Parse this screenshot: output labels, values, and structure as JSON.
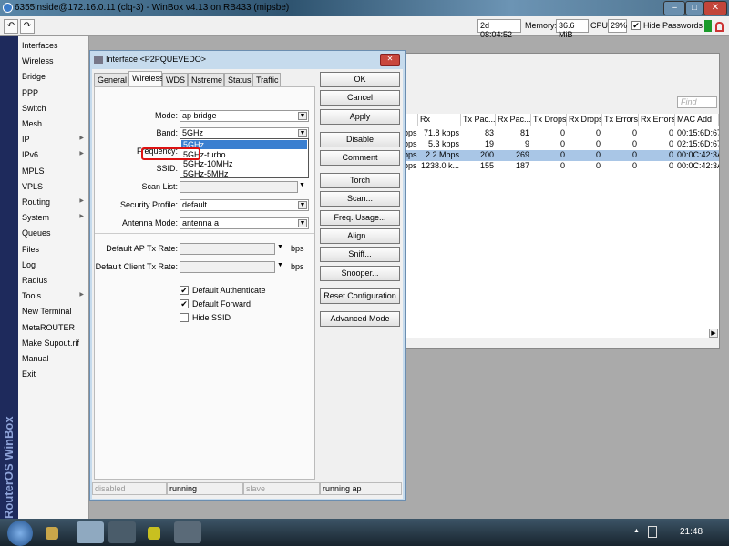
{
  "window": {
    "title": "6355inside@172.16.0.11 (clq-3) - WinBox v4.13 on RB433 (mipsbe)"
  },
  "toolbar": {
    "undo": "↶",
    "redo": "↷",
    "uptime": "2d 08:04:52",
    "memory_label": "Memory:",
    "memory": "36.6 MiB",
    "cpu_label": "CPU:",
    "cpu": "29%",
    "hide_passwords": "Hide Passwords",
    "hide_passwords_checked": true
  },
  "sidebar": {
    "brand": "RouterOS WinBox",
    "items": [
      {
        "label": "Interfaces",
        "arrow": ""
      },
      {
        "label": "Wireless",
        "arrow": ""
      },
      {
        "label": "Bridge",
        "arrow": ""
      },
      {
        "label": "PPP",
        "arrow": ""
      },
      {
        "label": "Switch",
        "arrow": ""
      },
      {
        "label": "Mesh",
        "arrow": ""
      },
      {
        "label": "IP",
        "arrow": "▶"
      },
      {
        "label": "IPv6",
        "arrow": "▶"
      },
      {
        "label": "MPLS",
        "arrow": ""
      },
      {
        "label": "VPLS",
        "arrow": ""
      },
      {
        "label": "Routing",
        "arrow": "▶"
      },
      {
        "label": "System",
        "arrow": "▶"
      },
      {
        "label": "Queues",
        "arrow": ""
      },
      {
        "label": "Files",
        "arrow": ""
      },
      {
        "label": "Log",
        "arrow": ""
      },
      {
        "label": "Radius",
        "arrow": ""
      },
      {
        "label": "Tools",
        "arrow": "▶"
      },
      {
        "label": "New Terminal",
        "arrow": ""
      },
      {
        "label": "MetaROUTER",
        "arrow": ""
      },
      {
        "label": "Make Supout.rif",
        "arrow": ""
      },
      {
        "label": "Manual",
        "arrow": ""
      },
      {
        "label": "Exit",
        "arrow": ""
      }
    ]
  },
  "interface_list": {
    "find_placeholder": "Find",
    "columns": [
      "",
      "Rx",
      "Tx Pac...",
      "Rx Pac...",
      "Tx Drops",
      "Rx Drops",
      "Tx Errors",
      "Rx Errors",
      "MAC Add"
    ],
    "rows": [
      [
        "bps",
        "71.8 kbps",
        "83",
        "81",
        "0",
        "0",
        "0",
        "0",
        "00:15:6D:67:"
      ],
      [
        "bps",
        "5.3 kbps",
        "19",
        "9",
        "0",
        "0",
        "0",
        "0",
        "02:15:6D:67:"
      ],
      [
        "bps",
        "2.2 Mbps",
        "200",
        "269",
        "0",
        "0",
        "0",
        "0",
        "00:0C:42:3A:"
      ],
      [
        "bps",
        "1238.0 k...",
        "155",
        "187",
        "0",
        "0",
        "0",
        "0",
        "00:0C:42:3A:"
      ]
    ],
    "selected_row": 2
  },
  "dialog": {
    "title": "Interface <P2PQUEVEDO>",
    "tabs": [
      "General",
      "Wireless",
      "WDS",
      "Nstreme",
      "Status",
      "Traffic"
    ],
    "active_tab": "Wireless",
    "fields": {
      "mode_label": "Mode:",
      "mode": "ap bridge",
      "band_label": "Band:",
      "band": "5GHz",
      "frequency_label": "Frequency:",
      "ssid_label": "SSID:",
      "scan_list_label": "Scan List:",
      "scan_list": "",
      "security_profile_label": "Security Profile:",
      "security_profile": "default",
      "antenna_mode_label": "Antenna Mode:",
      "antenna_mode": "antenna a",
      "ap_tx_rate_label": "Default AP Tx Rate:",
      "client_tx_rate_label": "Default Client Tx Rate:",
      "bps": "bps"
    },
    "band_options": [
      "5GHz",
      "5GHz-turbo",
      "5GHz-10MHz",
      "5GHz-5MHz"
    ],
    "highlighted_option": "5GHz-turbo",
    "checkboxes": [
      {
        "label": "Default Authenticate",
        "checked": true
      },
      {
        "label": "Default Forward",
        "checked": true
      },
      {
        "label": "Hide SSID",
        "checked": false
      }
    ],
    "buttons": [
      "OK",
      "Cancel",
      "Apply",
      "Disable",
      "Comment",
      "Torch",
      "Scan...",
      "Freq. Usage...",
      "Align...",
      "Sniff...",
      "Snooper...",
      "Reset Configuration",
      "Advanced Mode"
    ],
    "status": [
      "disabled",
      "running",
      "slave",
      "running ap"
    ]
  },
  "taskbar": {
    "clock": "21:48"
  }
}
